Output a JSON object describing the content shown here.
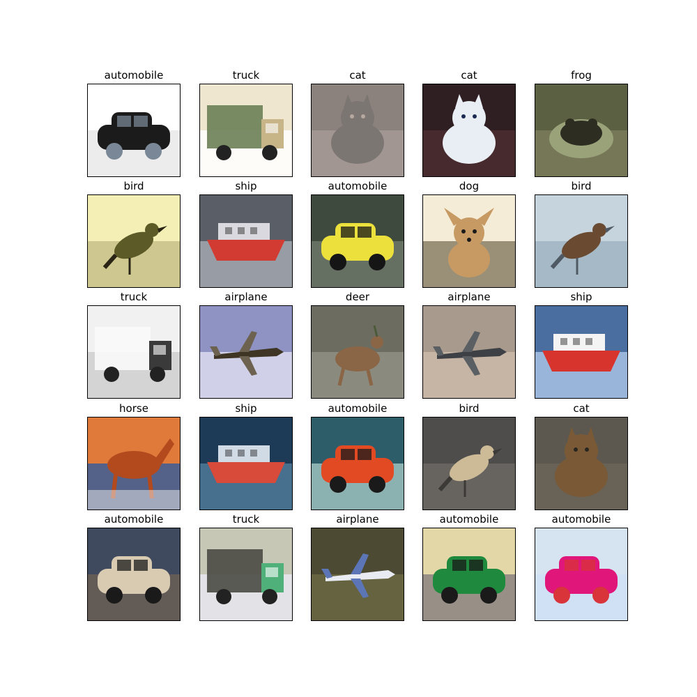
{
  "figure": {
    "title": "",
    "cells": [
      {
        "label": "automobile",
        "icon": "car-photo",
        "bg": [
          "#ffffff",
          "#e9e9e9"
        ],
        "main": "#1b1b1b",
        "accent": "#7a8796"
      },
      {
        "label": "truck",
        "icon": "truck-photo",
        "bg": [
          "#efe6cf",
          "#ffffff"
        ],
        "main": "#6a7f55",
        "accent": "#c7b487"
      },
      {
        "label": "cat",
        "icon": "cat-photo",
        "bg": [
          "#8c827d",
          "#a49a95"
        ],
        "main": "#7c7672",
        "accent": "#b8a9a0"
      },
      {
        "label": "cat",
        "icon": "cat-photo",
        "bg": [
          "#2f1f22",
          "#4a2d2f"
        ],
        "main": "#e9eef4",
        "accent": "#1a2a52"
      },
      {
        "label": "frog",
        "icon": "frog-photo",
        "bg": [
          "#5b6042",
          "#7a7b5a"
        ],
        "main": "#2e2d22",
        "accent": "#9aa27a"
      },
      {
        "label": "bird",
        "icon": "bird-photo",
        "bg": [
          "#f3efb5",
          "#c8c08a"
        ],
        "main": "#5c5a26",
        "accent": "#2a2416"
      },
      {
        "label": "ship",
        "icon": "ship-photo",
        "bg": [
          "#5a5e67",
          "#a3a8b0"
        ],
        "main": "#d23b32",
        "accent": "#d9d9df"
      },
      {
        "label": "automobile",
        "icon": "car-photo",
        "bg": [
          "#3e4a3d",
          "#6c7569"
        ],
        "main": "#ece13c",
        "accent": "#151515"
      },
      {
        "label": "dog",
        "icon": "dog-photo",
        "bg": [
          "#f4ecd6",
          "#8a8066"
        ],
        "main": "#c79a64",
        "accent": "#2e3a20"
      },
      {
        "label": "bird",
        "icon": "bird-photo",
        "bg": [
          "#c6d4de",
          "#9fb4c2"
        ],
        "main": "#6a4b32",
        "accent": "#505a64"
      },
      {
        "label": "truck",
        "icon": "truck-photo",
        "bg": [
          "#f1f1f1",
          "#cfcfcf"
        ],
        "main": "#fafafa",
        "accent": "#3a3a3a"
      },
      {
        "label": "airplane",
        "icon": "airplane-photo",
        "bg": [
          "#8f93c4",
          "#dcdcf0"
        ],
        "main": "#3e3524",
        "accent": "#6d6250"
      },
      {
        "label": "deer",
        "icon": "deer-photo",
        "bg": [
          "#6c6d60",
          "#8f8f84"
        ],
        "main": "#8a6646",
        "accent": "#4d5a3a"
      },
      {
        "label": "airplane",
        "icon": "airplane-photo",
        "bg": [
          "#a89a8c",
          "#cbb9a8"
        ],
        "main": "#3d4146",
        "accent": "#5a5f63"
      },
      {
        "label": "ship",
        "icon": "ship-photo",
        "bg": [
          "#4a6ea0",
          "#a7c2e3"
        ],
        "main": "#d8342e",
        "accent": "#f4f4f4"
      },
      {
        "label": "horse",
        "icon": "horse-photo",
        "bg": [
          "#e07a3a",
          "#3b5d96"
        ],
        "main": "#b24a1e",
        "accent": "#f2f2f2"
      },
      {
        "label": "ship",
        "icon": "ship-photo",
        "bg": [
          "#1d3a57",
          "#4d7a98"
        ],
        "main": "#d84b3b",
        "accent": "#d0dbe6"
      },
      {
        "label": "automobile",
        "icon": "car-photo",
        "bg": [
          "#2e5d6a",
          "#9cc0bd"
        ],
        "main": "#e24a24",
        "accent": "#1a1a1a"
      },
      {
        "label": "bird",
        "icon": "bird-photo",
        "bg": [
          "#4f4d4b",
          "#6b6763"
        ],
        "main": "#cdbb98",
        "accent": "#3c3a36"
      },
      {
        "label": "cat",
        "icon": "cat-photo",
        "bg": [
          "#5c584f",
          "#6a6458"
        ],
        "main": "#7a5a36",
        "accent": "#2a2620"
      },
      {
        "label": "automobile",
        "icon": "car-photo",
        "bg": [
          "#3f4a5e",
          "#6a5f55"
        ],
        "main": "#d9cbb2",
        "accent": "#1a1a1a"
      },
      {
        "label": "truck",
        "icon": "truck-photo",
        "bg": [
          "#c6c8b5",
          "#e8e8f0"
        ],
        "main": "#4a4a44",
        "accent": "#4fb07a"
      },
      {
        "label": "airplane",
        "icon": "airplane-photo",
        "bg": [
          "#4d4a33",
          "#6b6744"
        ],
        "main": "#e8ebf2",
        "accent": "#5b75b6"
      },
      {
        "label": "automobile",
        "icon": "car-photo",
        "bg": [
          "#e4d7a7",
          "#8b8481"
        ],
        "main": "#1f8a3e",
        "accent": "#1a1a1a"
      },
      {
        "label": "automobile",
        "icon": "car-photo",
        "bg": [
          "#d6e4f2",
          "#cfe1f6"
        ],
        "main": "#e0167a",
        "accent": "#d8343a"
      }
    ]
  }
}
